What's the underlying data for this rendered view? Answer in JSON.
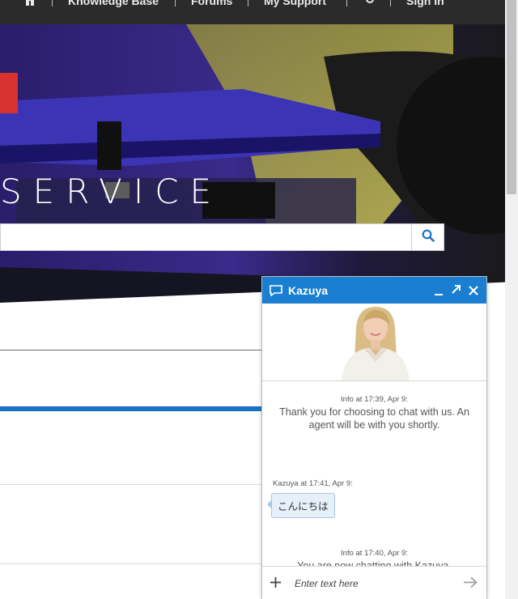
{
  "nav": {
    "items": [
      "Knowledge Base",
      "Forums",
      "My Support"
    ],
    "signin": "Sign In",
    "icons": [
      "home-icon",
      "search-icon"
    ]
  },
  "hero": {
    "title": "SERVICE",
    "search_placeholder": ""
  },
  "chat": {
    "agent_name": "Kazuya",
    "accent_color": "#1a7fd0",
    "messages": [
      {
        "meta": "Info at 17:39, Apr 9:",
        "text": "Thank you for choosing to chat with us. An agent will be with you shortly."
      },
      {
        "meta": "Info at 17:40, Apr 9:",
        "text": "You are now chatting with Kazuya."
      }
    ],
    "agent_message": {
      "meta": "Kazuya at 17:41, Apr 9:",
      "text": "こんにちは"
    },
    "input_placeholder": "Enter text here"
  }
}
